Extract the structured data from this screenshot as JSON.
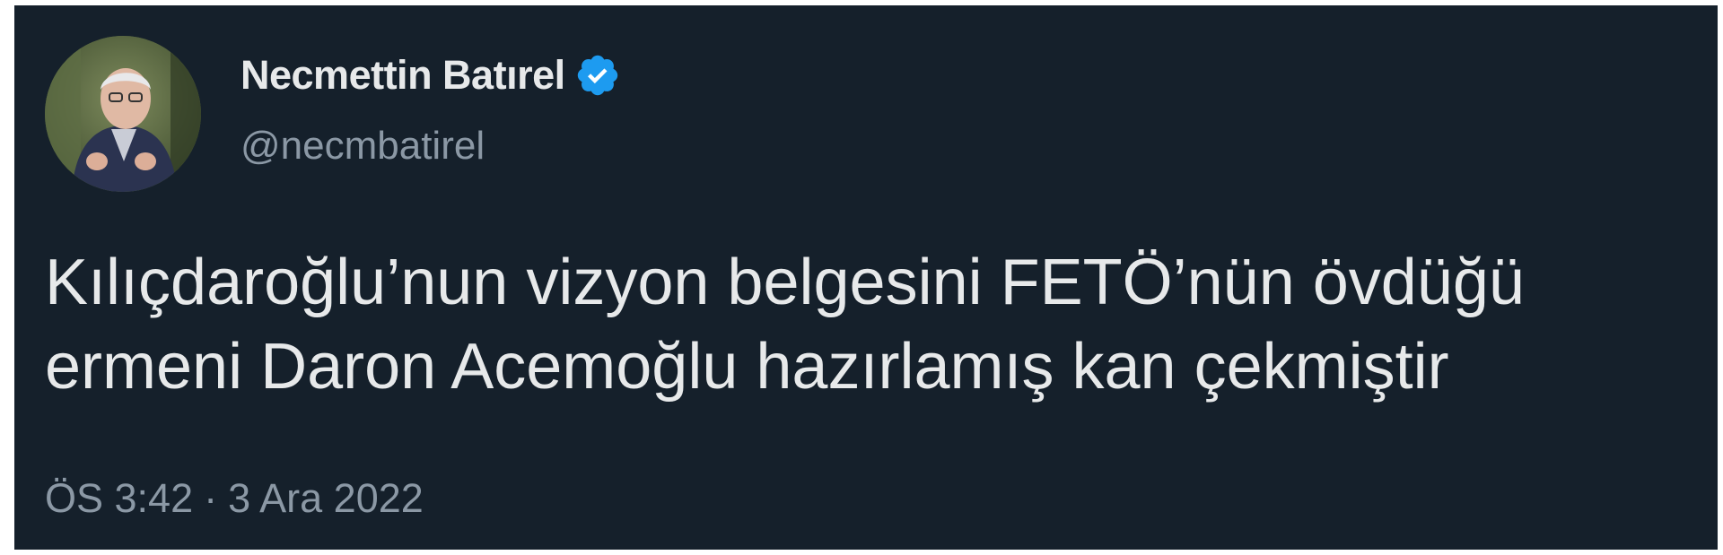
{
  "author": {
    "display_name": "Necmettin Batırel",
    "handle": "@necmbatirel",
    "verified_icon": "verified-badge-icon",
    "verified_color": "#1d9bf0"
  },
  "tweet": {
    "text": "Kılıçdaroğlu’nun vizyon belgesini FETÖ’nün övdüğü\nermeni Daron Acemoğlu hazırlamış kan çekmiştir",
    "time": "ÖS 3:42",
    "separator": "·",
    "date": "3 Ara 2022"
  },
  "colors": {
    "background": "#15202b",
    "primary_text": "#e7e9ea",
    "secondary_text": "#8b98a5"
  }
}
